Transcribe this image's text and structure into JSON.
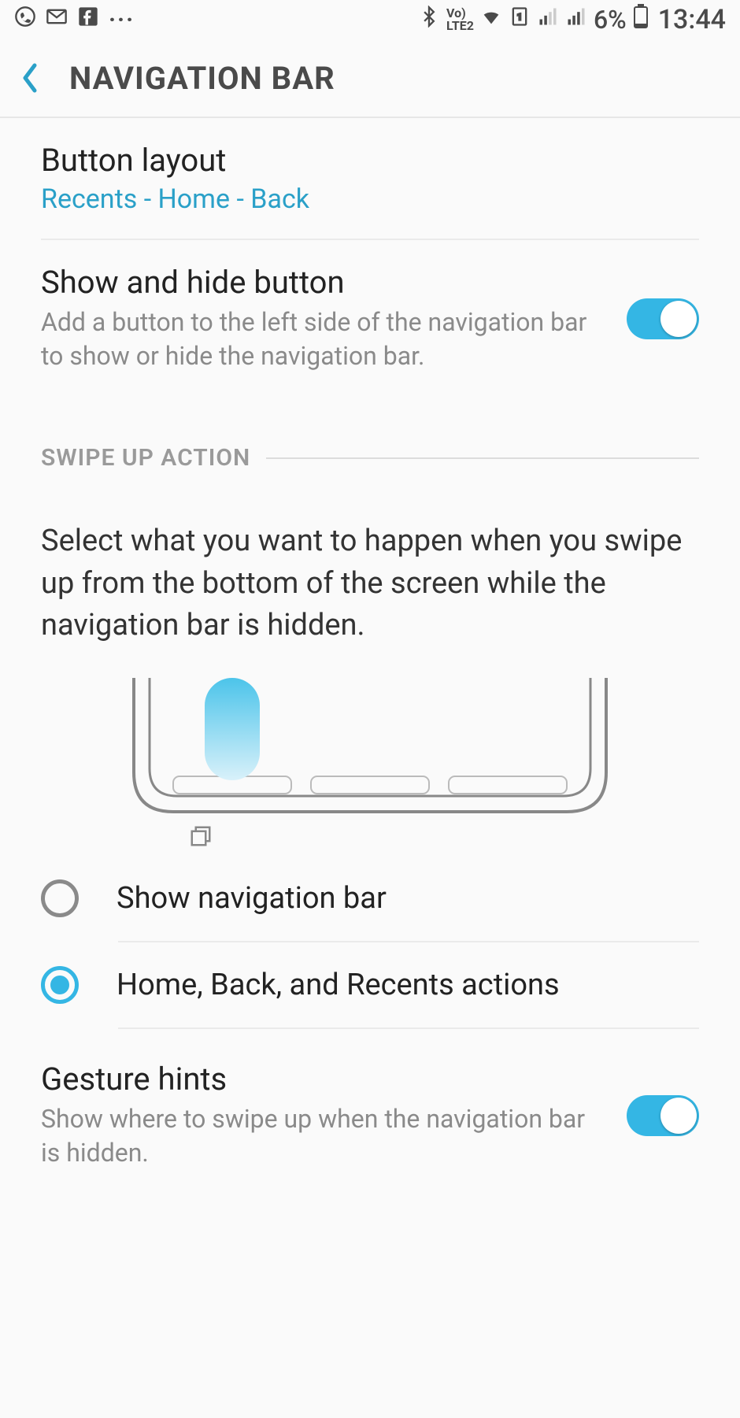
{
  "status": {
    "battery_pct": "6%",
    "clock": "13:44",
    "lte_label": "LTE2"
  },
  "header": {
    "title": "NAVIGATION BAR"
  },
  "button_layout": {
    "title": "Button layout",
    "value": "Recents - Home - Back"
  },
  "show_hide": {
    "title": "Show and hide button",
    "sub": "Add a button to the left side of the navigation bar to show or hide the navigation bar.",
    "enabled": true
  },
  "swipe_section": {
    "header": "SWIPE UP ACTION",
    "description": "Select what you want to happen when you swipe up from the bottom of the screen while the navigation bar is hidden.",
    "options": [
      {
        "label": "Show navigation bar",
        "selected": false
      },
      {
        "label": "Home, Back, and Recents actions",
        "selected": true
      }
    ]
  },
  "gesture_hints": {
    "title": "Gesture hints",
    "sub": "Show where to swipe up when the navigation bar is hidden.",
    "enabled": true
  }
}
